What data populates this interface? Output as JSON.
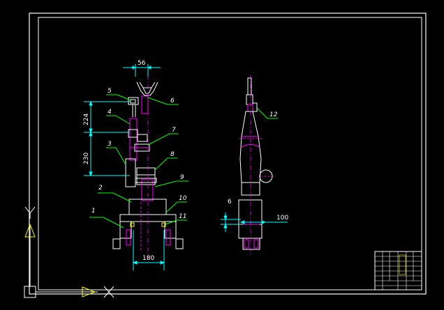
{
  "drawing": {
    "colors": {
      "background": "#000000",
      "frame": "#ffffff",
      "part": "#ffffff",
      "component": "#ff00ff",
      "dimension": "#00ffff",
      "leader": "#00ff00",
      "axis": "#ffff00",
      "centerline": "#ff00ff",
      "highlight": "#ffff00"
    },
    "dimensions": {
      "top_width": "56",
      "upper_height": "224",
      "lower_height": "230",
      "base_width": "180",
      "side_gap": "6",
      "side_offset": "100"
    },
    "balloons": [
      "1",
      "2",
      "3",
      "4",
      "5",
      "6",
      "7",
      "8",
      "9",
      "10",
      "11",
      "12"
    ],
    "ucs": {
      "y_label": "Y",
      "x_label": "X",
      "icon": "ucs-axis-icon"
    },
    "title_block": {
      "icon": "title-block-table"
    }
  }
}
